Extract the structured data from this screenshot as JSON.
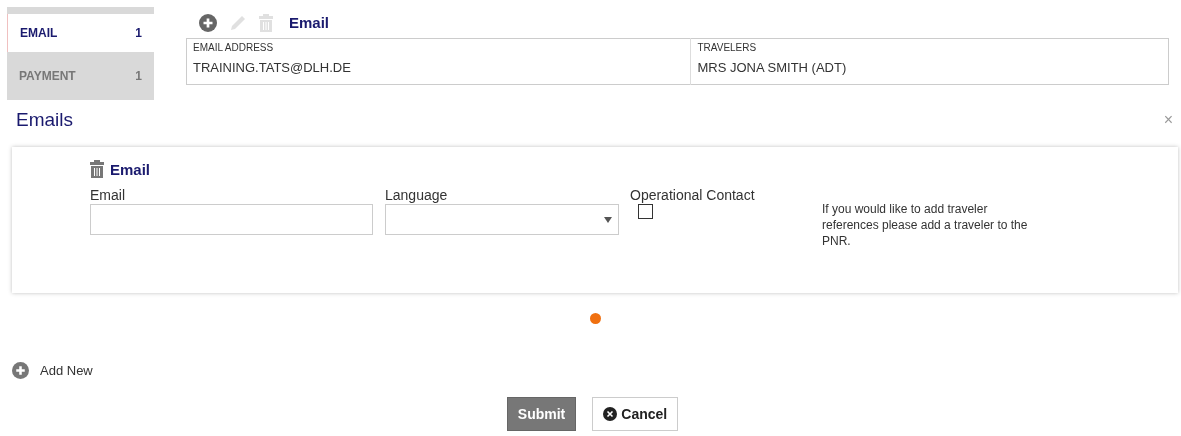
{
  "sidebar": {
    "items": [
      {
        "label": "EMAIL",
        "count": "1",
        "selected": true
      },
      {
        "label": "PAYMENT",
        "count": "1",
        "selected": false
      }
    ]
  },
  "summary": {
    "toolbar": [
      {
        "kind": "add",
        "disabled": false
      },
      {
        "kind": "edit",
        "disabled": true
      },
      {
        "kind": "delete",
        "disabled": true
      }
    ],
    "title": "Email",
    "table": {
      "columns": [
        "EMAIL ADDRESS",
        "TRAVELERS"
      ],
      "rows": [
        [
          "TRAINING.TATS@DLH.DE",
          "MRS JONA SMITH (ADT)"
        ]
      ]
    }
  },
  "dialog": {
    "title": "Emails",
    "close": "×",
    "entry": {
      "title": "Email",
      "email_label": "Email",
      "language_label": "Language",
      "operational_label": "Operational Contact",
      "operational_checked": false,
      "note": "If you would like to add traveler references please add a traveler to the PNR."
    },
    "add_new": "Add New",
    "buttons": [
      {
        "kind": "primary",
        "label": "Submit"
      },
      {
        "kind": "cancel",
        "label": "Cancel"
      }
    ]
  }
}
